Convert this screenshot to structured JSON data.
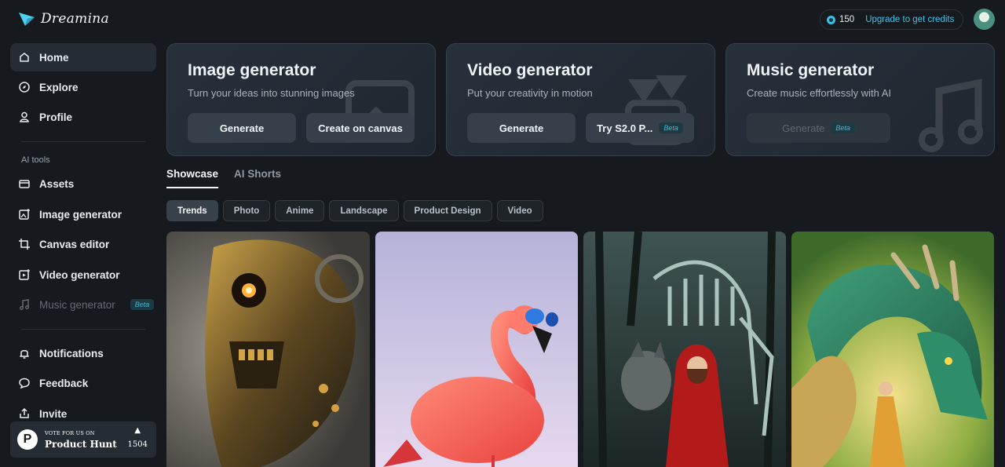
{
  "app": {
    "name": "Dreamina"
  },
  "sidebar": {
    "items": [
      {
        "label": "Home"
      },
      {
        "label": "Explore"
      },
      {
        "label": "Profile"
      }
    ],
    "section_label": "AI tools",
    "tools": [
      {
        "label": "Assets"
      },
      {
        "label": "Image generator"
      },
      {
        "label": "Canvas editor"
      },
      {
        "label": "Video generator"
      },
      {
        "label": "Music generator",
        "badge": "Beta"
      }
    ],
    "bottom": [
      {
        "label": "Notifications"
      },
      {
        "label": "Feedback"
      },
      {
        "label": "Invite"
      }
    ],
    "product_hunt": {
      "small": "VOTE FOR US ON",
      "big": "Product Hunt",
      "votes": "1504",
      "logo": "P"
    }
  },
  "topbar": {
    "credits": "150",
    "upgrade": "Upgrade to get credits"
  },
  "cards": [
    {
      "title": "Image generator",
      "subtitle": "Turn your ideas into stunning images",
      "btn1": "Generate",
      "btn2": "Create on canvas"
    },
    {
      "title": "Video generator",
      "subtitle": "Put your creativity in motion",
      "btn1": "Generate",
      "btn2": "Try S2.0 P...",
      "btn2_badge": "Beta"
    },
    {
      "title": "Music generator",
      "subtitle": "Create music effortlessly with AI",
      "btn1": "Generate",
      "btn1_badge": "Beta"
    }
  ],
  "tabs": [
    "Showcase",
    "AI Shorts"
  ],
  "chips": [
    "Trends",
    "Photo",
    "Anime",
    "Landscape",
    "Product Design",
    "Video"
  ],
  "colors": {
    "accent": "#3fc2e6",
    "background": "#161a1f",
    "active_item": "#262c33"
  }
}
